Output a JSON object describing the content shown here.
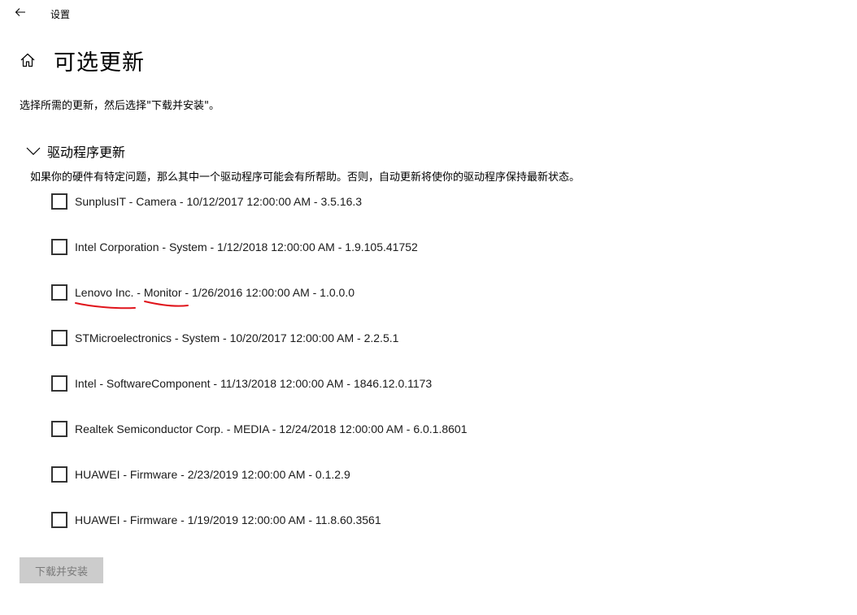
{
  "window": {
    "app_title": "设置"
  },
  "page": {
    "title": "可选更新",
    "description": "选择所需的更新，然后选择\"下载并安装\"。"
  },
  "section": {
    "title": "驱动程序更新",
    "description": "如果你的硬件有特定问题，那么其中一个驱动程序可能会有所帮助。否则，自动更新将使你的驱动程序保持最新状态。",
    "expanded": true
  },
  "updates": [
    {
      "label": "SunplusIT - Camera - 10/12/2017 12:00:00 AM - 3.5.16.3",
      "checked": false
    },
    {
      "label": "Intel Corporation - System - 1/12/2018 12:00:00 AM - 1.9.105.41752",
      "checked": false
    },
    {
      "label": "Lenovo Inc. - Monitor - 1/26/2016 12:00:00 AM - 1.0.0.0",
      "checked": false
    },
    {
      "label": "STMicroelectronics - System - 10/20/2017 12:00:00 AM - 2.2.5.1",
      "checked": false
    },
    {
      "label": "Intel - SoftwareComponent - 11/13/2018 12:00:00 AM - 1846.12.0.1173",
      "checked": false
    },
    {
      "label": "Realtek Semiconductor Corp. - MEDIA - 12/24/2018 12:00:00 AM - 6.0.1.8601",
      "checked": false
    },
    {
      "label": "HUAWEI - Firmware - 2/23/2019 12:00:00 AM - 0.1.2.9",
      "checked": false
    },
    {
      "label": "HUAWEI - Firmware - 1/19/2019 12:00:00 AM - 11.8.60.3561",
      "checked": false
    }
  ],
  "actions": {
    "download_install_label": "下载并安装",
    "download_install_enabled": false
  },
  "icons": {
    "back": "back-arrow-icon",
    "home": "home-icon",
    "section_toggle": "chevron-down-icon"
  },
  "colors": {
    "annotation": "#e0141b",
    "button_disabled_bg": "#cccccc",
    "button_disabled_text": "#7a7a7a"
  }
}
